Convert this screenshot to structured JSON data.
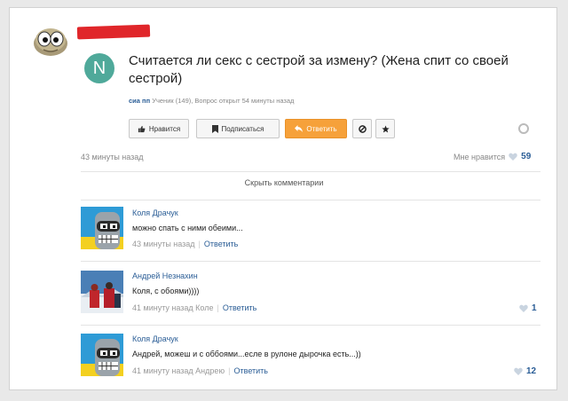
{
  "question": {
    "badge_letter": "N",
    "title": "Считается ли секс с сестрой за измену? (Жена спит со своей сестрой)",
    "author": "сиа пп",
    "author_info": "Ученик (149), Вопрос открыт 54 минуты назад",
    "time": "43 минуты назад",
    "likes_label": "Мне нравится",
    "likes_count": "59"
  },
  "toolbar": {
    "like_label": "Нравится",
    "subscribe_label": "Подписаться",
    "reply_label": "Ответить"
  },
  "hide_comments_label": "Скрыть комментарии",
  "comments": [
    {
      "author": "Коля Драчук",
      "text": "можно спать с ними обеими...",
      "time": "43 минуты назад",
      "reply_label": "Ответить",
      "likes": ""
    },
    {
      "author": "Андрей Незнахин",
      "text": "Коля, с обоями))))",
      "time": "41 минуту назад Коле",
      "reply_label": "Ответить",
      "likes": "1"
    },
    {
      "author": "Коля Драчук",
      "text": "Андрей, можеш и с оббоями...есле в рулоне дырочка есть...))",
      "time": "41 минуту назад Андрею",
      "reply_label": "Ответить",
      "likes": "12"
    }
  ],
  "icons": {
    "thumb": "thumbs-up-icon",
    "bookmark": "bookmark-icon",
    "reply": "reply-arrow-icon",
    "block": "block-icon",
    "star": "star-icon",
    "heart": "heart-icon",
    "settings": "settings-icon"
  },
  "colors": {
    "accent": "#2a5d96",
    "orange": "#f6a13a",
    "badge": "#4fa99a",
    "redaction": "#e0262a"
  }
}
